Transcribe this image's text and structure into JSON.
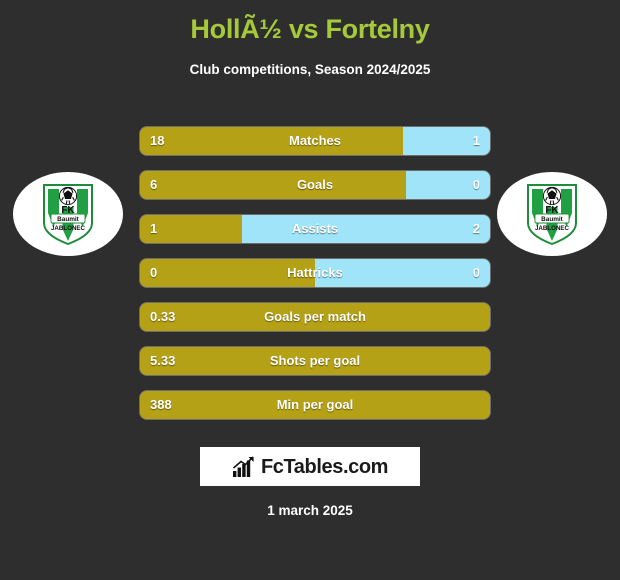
{
  "header": {
    "title": "HollÃ½ vs Fortelny",
    "subtitle": "Club competitions, Season 2024/2025"
  },
  "teams": {
    "home": {
      "crest_name": "fk-baumit-jablonec-crest",
      "line1": "FK",
      "line2": "Baumit",
      "line3": "JABLONEC"
    },
    "away": {
      "crest_name": "fk-baumit-jablonec-crest",
      "line1": "FK",
      "line2": "Baumit",
      "line3": "JABLONEC"
    }
  },
  "colors": {
    "background": "#2E2E2E",
    "title_green": "#A5C939",
    "home_gold": "#B5A116",
    "away_blue": "#9FE4F8",
    "text_white": "#FFFFFF"
  },
  "stats": [
    {
      "label": "Matches",
      "home": "18",
      "away": "1",
      "home_percent": 75,
      "dual": true
    },
    {
      "label": "Goals",
      "home": "6",
      "away": "0",
      "home_percent": 76,
      "dual": true
    },
    {
      "label": "Assists",
      "home": "1",
      "away": "2",
      "home_percent": 29,
      "dual": true
    },
    {
      "label": "Hattricks",
      "home": "0",
      "away": "0",
      "home_percent": 50,
      "dual": true
    },
    {
      "label": "Goals per match",
      "home": "0.33",
      "away": "",
      "home_percent": 100,
      "dual": false
    },
    {
      "label": "Shots per goal",
      "home": "5.33",
      "away": "",
      "home_percent": 100,
      "dual": false
    },
    {
      "label": "Min per goal",
      "home": "388",
      "away": "",
      "home_percent": 100,
      "dual": false
    }
  ],
  "footer": {
    "logo_text": "FcTables.com",
    "logo_icon": "bar-chart-icon",
    "date": "1 march 2025"
  },
  "chart_data": {
    "type": "bar",
    "title": "HollÃ½ vs Fortelny",
    "subtitle": "Club competitions, Season 2024/2025",
    "orientation": "horizontal",
    "categories": [
      "Matches",
      "Goals",
      "Assists",
      "Hattricks",
      "Goals per match",
      "Shots per goal",
      "Min per goal"
    ],
    "series": [
      {
        "name": "HollÃ½",
        "color": "#B5A116",
        "values": [
          18,
          6,
          1,
          0,
          0.33,
          5.33,
          388
        ]
      },
      {
        "name": "Fortelny",
        "color": "#9FE4F8",
        "values": [
          1,
          0,
          2,
          0,
          null,
          null,
          null
        ]
      }
    ],
    "legend": "none",
    "grid": false,
    "xlabel": "",
    "ylabel": ""
  }
}
